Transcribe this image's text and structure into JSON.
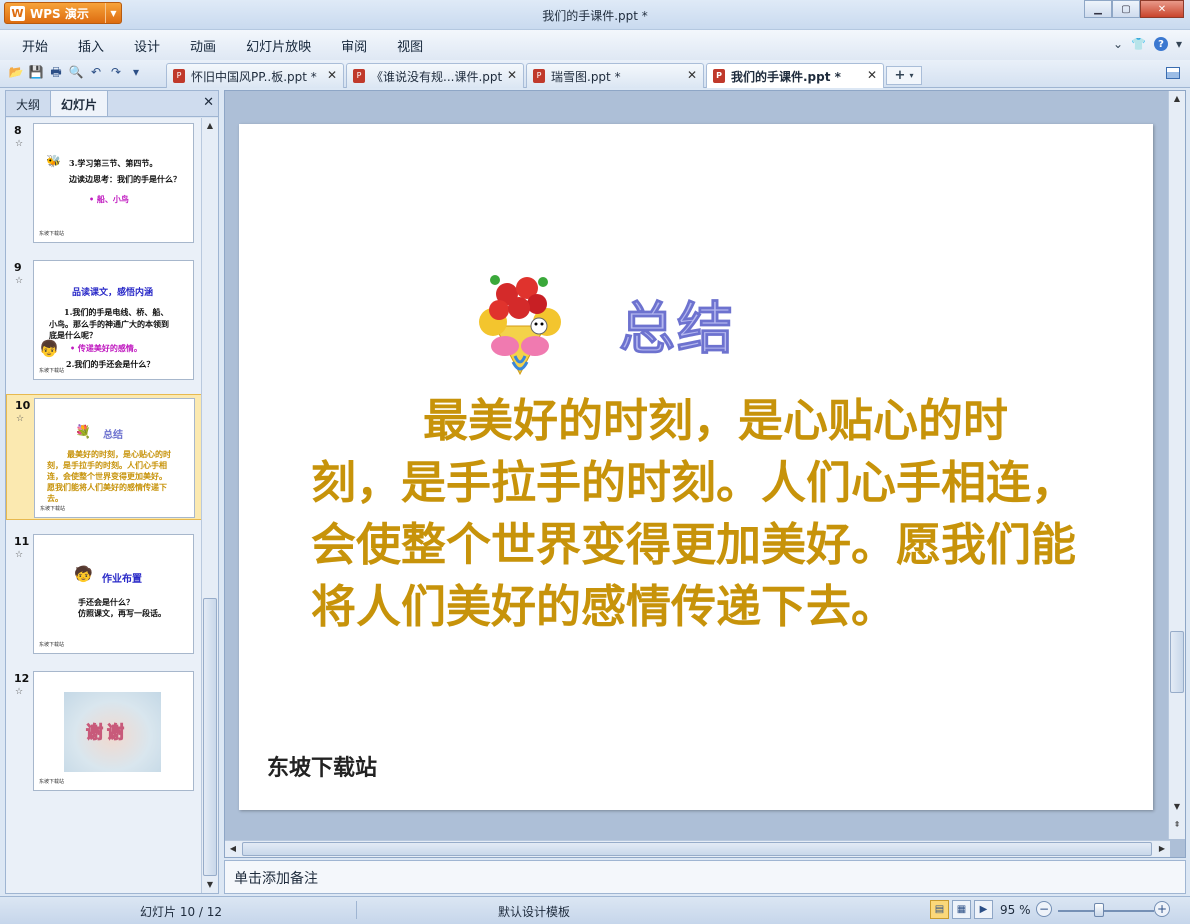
{
  "app": {
    "button_label": "WPS 演示",
    "logo_glyph": "W",
    "window_title": "我们的手课件.ppt *"
  },
  "menu": {
    "items": [
      "开始",
      "插入",
      "设计",
      "动画",
      "幻灯片放映",
      "审阅",
      "视图"
    ]
  },
  "doc_tabs": [
    {
      "label": "怀旧中国风PP..板.ppt *",
      "active": false
    },
    {
      "label": "《谁说没有规...课件.ppt",
      "active": false
    },
    {
      "label": "瑞雪图.ppt *",
      "active": false
    },
    {
      "label": "我们的手课件.ppt *",
      "active": true
    }
  ],
  "left_pane": {
    "tabs": [
      "大纲",
      "幻灯片"
    ],
    "active_tab": "幻灯片",
    "thumbnails": [
      {
        "number": "8",
        "lines": [
          "3.学习第三节、第四节。",
          "边读边思考：我们的手是什么？",
          "• 船、小鸟"
        ],
        "footer": "东坡下载站"
      },
      {
        "number": "9",
        "title": "品读课文，感悟内涵",
        "lines": [
          "1.我们的手是电线、桥、船、",
          "小鸟。那么手的神通广大的本领到",
          "底是什么呢？",
          "• 传递美好的感情。",
          "2.我们的手还会是什么？"
        ],
        "footer": "东坡下载站"
      },
      {
        "number": "10",
        "title": "总结",
        "lines": [
          "最美好的时刻，是心贴心的时",
          "刻，是手拉手的时刻。人们心手相",
          "连，会使整个世界变得更加美好。",
          "愿我们能将人们美好的感情传递下",
          "去。"
        ],
        "footer": "东坡下载站",
        "selected": true
      },
      {
        "number": "11",
        "title": "作业布置",
        "lines": [
          "手还会是什么？",
          "仿照课文，再写一段话。"
        ],
        "footer": "东坡下载站"
      },
      {
        "number": "12",
        "image_text": "谢谢",
        "footer": "东坡下载站"
      }
    ]
  },
  "slide": {
    "title": "总结",
    "body": "最美好的时刻，是心贴心的时刻，是手拉手的时刻。人们心手相连，会使整个世界变得更加美好。愿我们能将人们美好的感情传递下去。",
    "footer": "东坡下载站"
  },
  "notes_placeholder": "单击添加备注",
  "status": {
    "slide_counter": "幻灯片 10 / 12",
    "template": "默认设计模板",
    "zoom": "95 %"
  },
  "colors": {
    "slide_body": "#c7930a",
    "slide_title": "#b5b8ef",
    "accent": "#dd6c10"
  }
}
